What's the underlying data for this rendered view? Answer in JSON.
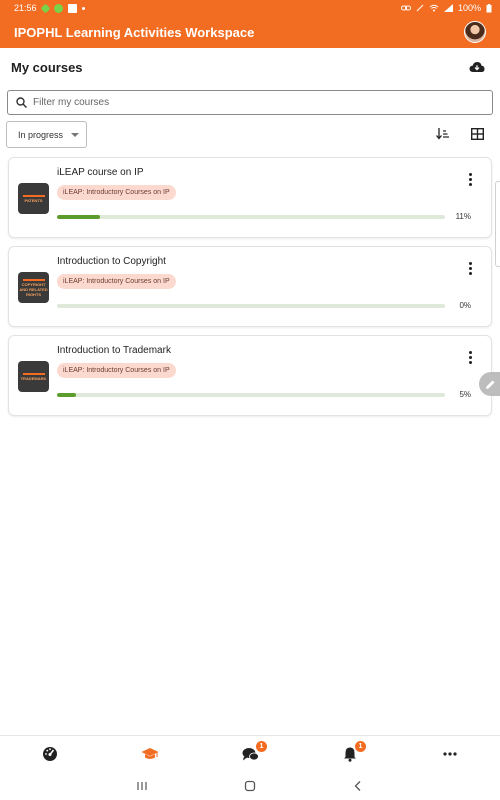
{
  "status_bar": {
    "time": "21:56",
    "battery": "100%"
  },
  "app": {
    "title": "IPOPHL Learning Activities Workspace"
  },
  "header": {
    "title": "My courses"
  },
  "search": {
    "placeholder": "Filter my courses"
  },
  "filter": {
    "selected": "In progress"
  },
  "courses": [
    {
      "name": "iLEAP course on IP",
      "category": "iLEAP: Introductory Courses on IP",
      "progress": 11,
      "progress_label": "11%",
      "thumb_text": "PATENTS"
    },
    {
      "name": "Introduction to Copyright",
      "category": "iLEAP: Introductory Courses on IP",
      "progress": 0,
      "progress_label": "0%",
      "thumb_text": "COPYRIGHT AND RELATED RIGHTS"
    },
    {
      "name": "Introduction to Trademark",
      "category": "iLEAP: Introductory Courses on IP",
      "progress": 5,
      "progress_label": "5%",
      "thumb_text": "TRADEMARK"
    }
  ],
  "bottom_nav": [
    {
      "icon": "dashboard-icon"
    },
    {
      "icon": "graduation-cap-icon",
      "active": true
    },
    {
      "icon": "messages-icon",
      "badge": "1"
    },
    {
      "icon": "bell-icon",
      "badge": "1"
    },
    {
      "icon": "more-horizontal-icon"
    }
  ],
  "colors": {
    "brand": "#f26c21",
    "progress": "#5c9c2c",
    "badge_bg": "#fcd9cf"
  }
}
